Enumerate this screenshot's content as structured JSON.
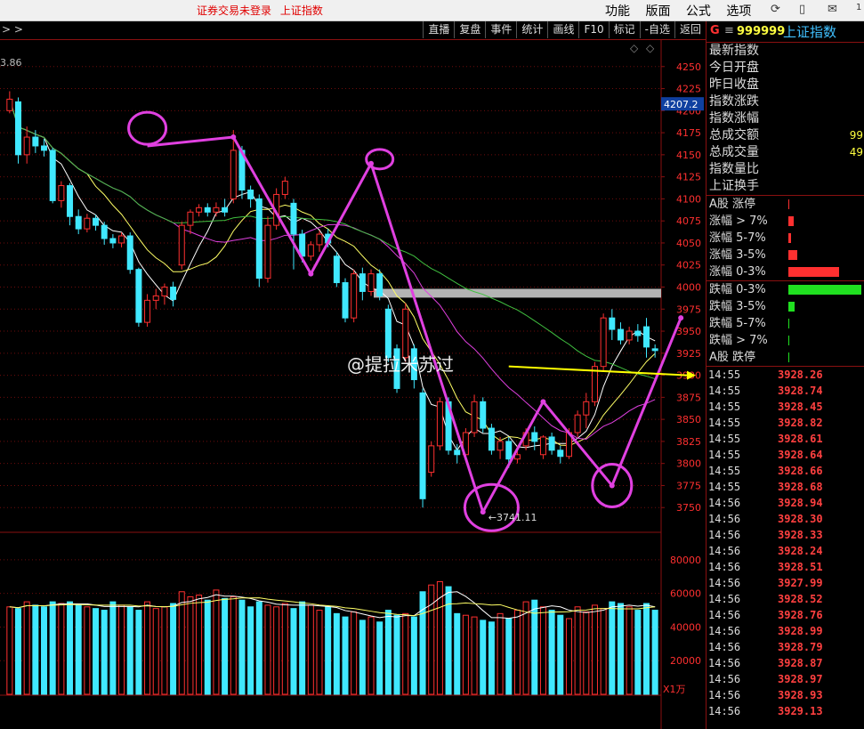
{
  "menubar": {
    "status": [
      "证券交易未登录",
      "上证指数"
    ],
    "menus": [
      "功能",
      "版面",
      "公式",
      "选项"
    ],
    "icons": [
      "refresh-icon",
      "phone-icon",
      "mail-icon"
    ],
    "badge": "1"
  },
  "toolbar": {
    "crumb": "> >",
    "buttons": [
      "直播",
      "复盘",
      "事件",
      "统计",
      "画线",
      "F10",
      "标记",
      "-自选",
      "返回"
    ]
  },
  "colors": {
    "up": "#ff3030",
    "down": "#40e8ff",
    "bg": "#000000",
    "grid": "#8a1010",
    "arrow": "#e040e0",
    "trend": "#ffff00",
    "ma5": "#ffffff",
    "ma10": "#ffff66",
    "ma20": "#e040e0",
    "ma60": "#40c040"
  },
  "right_panel": {
    "market": "G",
    "eq": "≡",
    "code": "999999",
    "name": "上证指数",
    "quote": [
      {
        "label": "最新指数",
        "value": ""
      },
      {
        "label": "今日开盘",
        "value": ""
      },
      {
        "label": "昨日收盘",
        "value": ""
      },
      {
        "label": "指数涨跌",
        "value": ""
      },
      {
        "label": "指数涨幅",
        "value": ""
      },
      {
        "label": "总成交额",
        "value": "99"
      },
      {
        "label": "总成交量",
        "value": "49"
      },
      {
        "label": "指数量比",
        "value": ""
      },
      {
        "label": "上证换手",
        "value": ""
      }
    ],
    "breadth_up": [
      {
        "label": "A股 涨停",
        "ratio": 0.01
      },
      {
        "label": "涨幅 > 7%",
        "ratio": 0.07
      },
      {
        "label": "涨幅 5-7%",
        "ratio": 0.04
      },
      {
        "label": "涨幅 3-5%",
        "ratio": 0.12
      },
      {
        "label": "涨幅 0-3%",
        "ratio": 0.7
      }
    ],
    "breadth_down": [
      {
        "label": "跌幅 0-3%",
        "ratio": 1.0
      },
      {
        "label": "跌幅 3-5%",
        "ratio": 0.09
      },
      {
        "label": "跌幅 5-7%",
        "ratio": 0.01
      },
      {
        "label": "跌幅 > 7%",
        "ratio": 0.01
      },
      {
        "label": "A股 跌停",
        "ratio": 0.01
      }
    ],
    "ticks": [
      [
        "14:55",
        "3928.26"
      ],
      [
        "14:55",
        "3928.74"
      ],
      [
        "14:55",
        "3928.45"
      ],
      [
        "14:55",
        "3928.82"
      ],
      [
        "14:55",
        "3928.61"
      ],
      [
        "14:55",
        "3928.64"
      ],
      [
        "14:55",
        "3928.66"
      ],
      [
        "14:55",
        "3928.68"
      ],
      [
        "14:56",
        "3928.94"
      ],
      [
        "14:56",
        "3928.30"
      ],
      [
        "14:56",
        "3928.33"
      ],
      [
        "14:56",
        "3928.24"
      ],
      [
        "14:56",
        "3928.51"
      ],
      [
        "14:56",
        "3927.99"
      ],
      [
        "14:56",
        "3928.52"
      ],
      [
        "14:56",
        "3928.76"
      ],
      [
        "14:56",
        "3928.99"
      ],
      [
        "14:56",
        "3928.79"
      ],
      [
        "14:56",
        "3928.87"
      ],
      [
        "14:56",
        "3928.97"
      ],
      [
        "14:56",
        "3928.93"
      ],
      [
        "14:56",
        "3929.13"
      ]
    ]
  },
  "chart_data": {
    "type": "candlestick",
    "price_axis": {
      "ylim": [
        3725,
        4275
      ],
      "ticks": [
        3750,
        3775,
        3800,
        3825,
        3850,
        3875,
        3900,
        3925,
        3950,
        3975,
        4000,
        4025,
        4050,
        4075,
        4100,
        4125,
        4150,
        4175,
        4200,
        4225,
        4250
      ],
      "current_label": "4207.2"
    },
    "volume_axis": {
      "ylim": [
        0,
        90000
      ],
      "ticks": [
        20000,
        40000,
        60000,
        80000
      ],
      "unit": "X1万"
    },
    "labels": {
      "top_left_high": "3.86",
      "low_marker": "3741.11",
      "watermark": "@提拉米苏过"
    },
    "candles": [
      [
        4200,
        4213,
        4197,
        4222
      ],
      [
        4210,
        4150,
        4140,
        4215
      ],
      [
        4150,
        4170,
        4140,
        4182
      ],
      [
        4170,
        4160,
        4152,
        4178
      ],
      [
        4160,
        4155,
        4148,
        4168
      ],
      [
        4155,
        4098,
        4095,
        4158
      ],
      [
        4098,
        4115,
        4090,
        4120
      ],
      [
        4115,
        4080,
        4070,
        4118
      ],
      [
        4080,
        4066,
        4060,
        4088
      ],
      [
        4066,
        4078,
        4062,
        4083
      ],
      [
        4078,
        4070,
        4064,
        4082
      ],
      [
        4070,
        4055,
        4048,
        4074
      ],
      [
        4055,
        4050,
        4044,
        4060
      ],
      [
        4050,
        4058,
        4045,
        4062
      ],
      [
        4058,
        4020,
        4015,
        4062
      ],
      [
        4020,
        3960,
        3955,
        4022
      ],
      [
        3960,
        3985,
        3955,
        3992
      ],
      [
        3985,
        3990,
        3975,
        3998
      ],
      [
        3990,
        4000,
        3980,
        4004
      ],
      [
        4000,
        3986,
        3978,
        4006
      ],
      [
        4025,
        4070,
        4020,
        4074
      ],
      [
        4070,
        4085,
        4060,
        4088
      ],
      [
        4085,
        4090,
        4080,
        4094
      ],
      [
        4090,
        4085,
        4080,
        4095
      ],
      [
        4085,
        4090,
        4080,
        4096
      ],
      [
        4090,
        4085,
        4080,
        4100
      ],
      [
        4100,
        4155,
        4095,
        4178
      ],
      [
        4155,
        4110,
        4100,
        4160
      ],
      [
        4110,
        4100,
        4090,
        4115
      ],
      [
        4100,
        4010,
        4000,
        4105
      ],
      [
        4010,
        4070,
        4005,
        4080
      ],
      [
        4070,
        4105,
        4065,
        4112
      ],
      [
        4105,
        4120,
        4100,
        4125
      ],
      [
        4095,
        4060,
        4020,
        4100
      ],
      [
        4060,
        4035,
        4028,
        4065
      ],
      [
        4035,
        4048,
        4030,
        4052
      ],
      [
        4048,
        4060,
        4040,
        4064
      ],
      [
        4060,
        4050,
        4045,
        4066
      ],
      [
        4035,
        4005,
        4000,
        4040
      ],
      [
        4005,
        3965,
        3960,
        4010
      ],
      [
        3965,
        4015,
        3960,
        4020
      ],
      [
        4015,
        3995,
        3985,
        4022
      ],
      [
        3995,
        4015,
        3990,
        4020
      ],
      [
        4015,
        3990,
        3985,
        4020
      ],
      [
        3975,
        3920,
        3915,
        3980
      ],
      [
        3930,
        3885,
        3880,
        3935
      ],
      [
        3920,
        3975,
        3915,
        3982
      ],
      [
        3930,
        3895,
        3885,
        3935
      ],
      [
        3880,
        3760,
        3750,
        3885
      ],
      [
        3790,
        3820,
        3785,
        3825
      ],
      [
        3820,
        3870,
        3815,
        3875
      ],
      [
        3870,
        3815,
        3810,
        3875
      ],
      [
        3815,
        3810,
        3800,
        3822
      ],
      [
        3810,
        3835,
        3805,
        3840
      ],
      [
        3835,
        3870,
        3830,
        3878
      ],
      [
        3870,
        3840,
        3835,
        3875
      ],
      [
        3840,
        3815,
        3810,
        3845
      ],
      [
        3815,
        3825,
        3805,
        3830
      ],
      [
        3825,
        3805,
        3795,
        3830
      ],
      [
        3805,
        3810,
        3800,
        3820
      ],
      [
        3820,
        3835,
        3815,
        3840
      ],
      [
        3835,
        3825,
        3815,
        3842
      ],
      [
        3810,
        3830,
        3805,
        3832
      ],
      [
        3830,
        3815,
        3810,
        3835
      ],
      [
        3815,
        3808,
        3800,
        3820
      ],
      [
        3808,
        3835,
        3805,
        3840
      ],
      [
        3835,
        3855,
        3830,
        3860
      ],
      [
        3855,
        3870,
        3840,
        3880
      ],
      [
        3870,
        3910,
        3865,
        3915
      ],
      [
        3910,
        3965,
        3905,
        3970
      ],
      [
        3965,
        3952,
        3940,
        3975
      ],
      [
        3952,
        3940,
        3935,
        3960
      ],
      [
        3940,
        3950,
        3935,
        3955
      ],
      [
        3950,
        3945,
        3938,
        3958
      ],
      [
        3955,
        3932,
        3920,
        3965
      ],
      [
        3930,
        3928,
        3920,
        3935
      ]
    ],
    "volume": [
      52000,
      51000,
      55000,
      53000,
      52000,
      55000,
      54000,
      55000,
      53000,
      52000,
      51000,
      50000,
      55000,
      53000,
      52000,
      50000,
      55000,
      51000,
      52000,
      54000,
      61000,
      58000,
      59000,
      56000,
      62000,
      57000,
      58000,
      56000,
      52000,
      55000,
      53000,
      52000,
      54000,
      51000,
      55000,
      53000,
      50000,
      52000,
      48000,
      46000,
      49000,
      44000,
      46000,
      43000,
      50000,
      47000,
      48000,
      46000,
      61000,
      65000,
      67000,
      64000,
      48000,
      47000,
      46000,
      44000,
      43000,
      48000,
      45000,
      50000,
      55000,
      56000,
      52000,
      50000,
      47000,
      45000,
      52000,
      49000,
      53000,
      51000,
      55000,
      54000,
      52000,
      50000,
      54000,
      50000
    ]
  }
}
